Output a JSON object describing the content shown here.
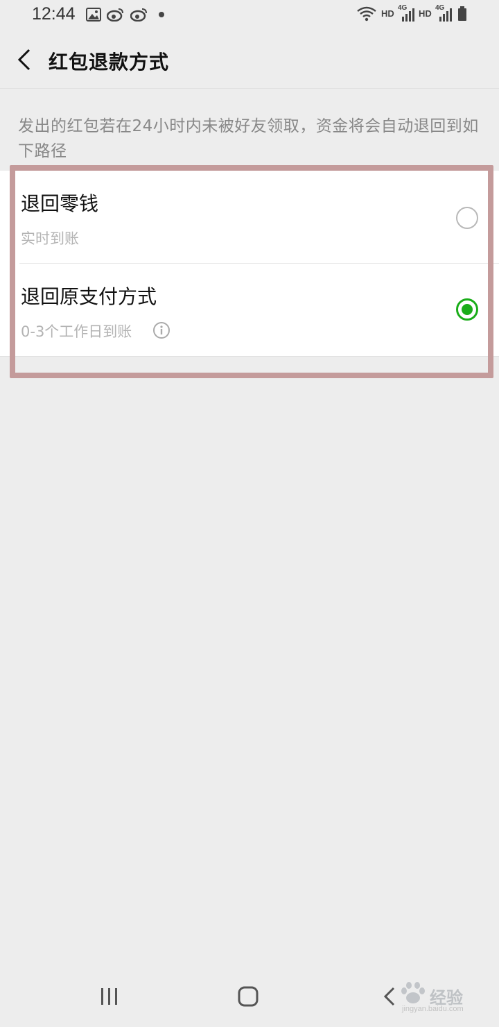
{
  "status_bar": {
    "time": "12:44",
    "hd_1": "HD",
    "net_1": "4G",
    "hd_2": "HD",
    "net_2": "4G",
    "icons": [
      "image-icon",
      "weibo-icon",
      "weibo-icon",
      "dot-icon",
      "wifi-icon",
      "signal-icon",
      "signal-icon",
      "battery-icon"
    ]
  },
  "header": {
    "title": "红包退款方式"
  },
  "description": "发出的红包若在24小时内未被好友领取，资金将会自动退回到如下路径",
  "options": [
    {
      "title": "退回零钱",
      "subtitle": "实时到账",
      "selected": false
    },
    {
      "title": "退回原支付方式",
      "subtitle": "0-3个工作日到账",
      "selected": true
    }
  ],
  "colors": {
    "accent": "#1aad19",
    "background": "#ededed",
    "highlight": "#c49b9b"
  },
  "watermark": {
    "text": "经验",
    "url": "jingyan.baidu.com"
  }
}
